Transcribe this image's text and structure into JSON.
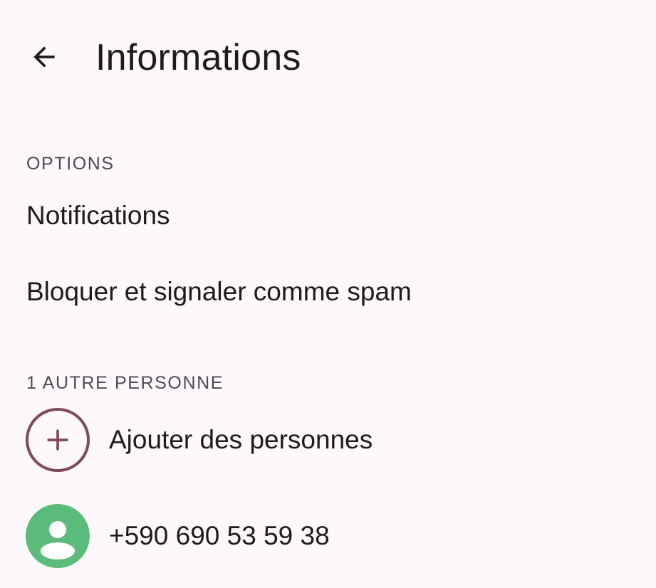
{
  "header": {
    "title": "Informations",
    "back_icon": "arrow-back-icon"
  },
  "options_section": {
    "header": "OPTIONS",
    "items": [
      {
        "label": "Notifications"
      },
      {
        "label": "Bloquer et signaler comme spam"
      }
    ]
  },
  "people_section": {
    "header": "1 AUTRE PERSONNE",
    "add_people": {
      "label": "Ajouter des personnes",
      "icon": "add-icon",
      "accent_color": "#7d4a5a"
    },
    "contacts": [
      {
        "label": "+590 690 53 59 38",
        "icon": "person-icon",
        "avatar_color": "#5bbb7b"
      }
    ]
  }
}
